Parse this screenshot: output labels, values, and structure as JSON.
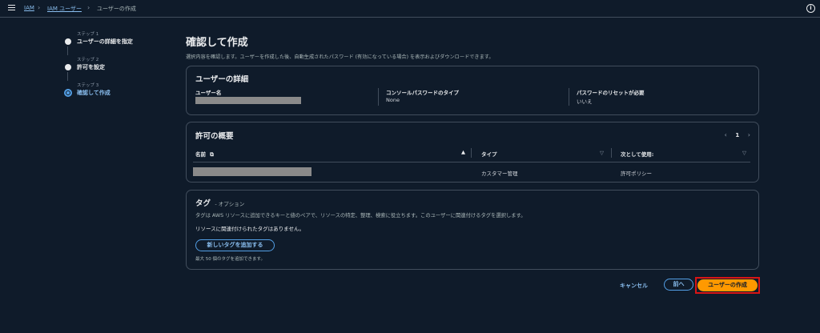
{
  "breadcrumb": {
    "items": [
      "IAM",
      "IAM ユーザー",
      "ユーザーの作成"
    ]
  },
  "steps": [
    {
      "number": "ステップ 1",
      "name": "ユーザーの詳細を指定"
    },
    {
      "number": "ステップ 2",
      "name": "許可を設定"
    },
    {
      "number": "ステップ 3",
      "name": "確認して作成"
    }
  ],
  "page": {
    "title": "確認して作成",
    "description": "選択内容を確認します。ユーザーを作成した後、自動生成されたパスワード (有効になっている場合) を表示およびダウンロードできます。"
  },
  "user_details": {
    "title": "ユーザーの詳細",
    "user_name_label": "ユーザー名",
    "console_pw_label": "コンソールパスワードのタイプ",
    "console_pw_value": "None",
    "pw_reset_label": "パスワードのリセットが必要",
    "pw_reset_value": "いいえ"
  },
  "permissions": {
    "title": "許可の概要",
    "page": "1",
    "columns": [
      "名前",
      "タイプ",
      "次として使用:"
    ],
    "rows": [
      {
        "type": "カスタマー管理",
        "used_as": "許可ポリシー"
      }
    ]
  },
  "tags": {
    "title": "タグ",
    "optional": "- オプション",
    "description": "タグは AWS リソースに追加できるキーと値のペアで、リソースの特定、整理、検索に役立ちます。このユーザーに関連付けるタグを選択します。",
    "empty_message": "リソースに関連付けられたタグはありません。",
    "add_button": "新しいタグを追加する",
    "limit_note": "最大 50 個のタグを追加できます。"
  },
  "actions": {
    "cancel": "キャンセル",
    "previous": "前へ",
    "create": "ユーザーの作成"
  },
  "colors": {
    "accent": "#539fe5",
    "primary_button": "#ff9900",
    "highlight": "#d91515",
    "background": "#0f1b2a"
  }
}
